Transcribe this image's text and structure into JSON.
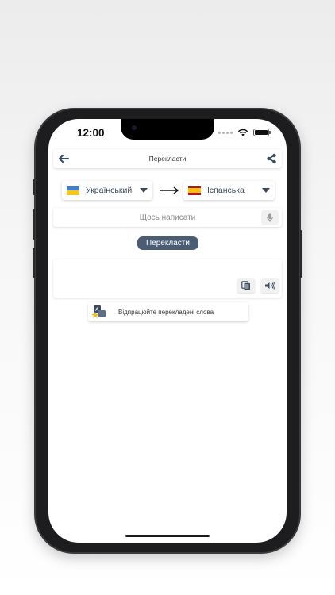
{
  "status_bar": {
    "time": "12:00"
  },
  "header": {
    "title": "Перекласти"
  },
  "languages": {
    "source": {
      "label": "Український",
      "flag_colors": [
        "#3f7fcf",
        "#f3c623"
      ]
    },
    "target": {
      "label": "Іспанська",
      "flag_colors": [
        "#c60b1e",
        "#ffc400",
        "#c60b1e"
      ]
    }
  },
  "input": {
    "placeholder": "Щось написати",
    "value": ""
  },
  "translate_button": {
    "label": "Перекласти"
  },
  "practice": {
    "label": "Відпрацюйте перекладені слова"
  },
  "colors": {
    "accent": "#4a5d74",
    "icon": "#3a4a5e"
  }
}
